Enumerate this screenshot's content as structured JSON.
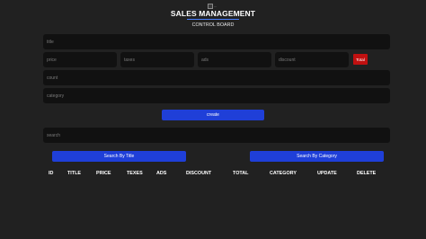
{
  "header": {
    "title": "SALES MANAGEMENT",
    "subtitle": "CONTROL BOARD",
    "logo_alt": "...",
    "underline_color": "#4a7fff"
  },
  "form": {
    "title_placeholder": "title",
    "price_placeholder": "price",
    "taxes_placeholder": "taxes",
    "ads_placeholder": "ads",
    "discount_placeholder": "discount",
    "total_label": "Total",
    "count_placeholder": "count",
    "category_placeholder": "category",
    "create_label": "create"
  },
  "search": {
    "placeholder": "search",
    "by_title_label": "Search By Title",
    "by_category_label": "Search By Category"
  },
  "table": {
    "headers": [
      "ID",
      "TITLE",
      "PRICE",
      "TEXES",
      "ADS",
      "DISCOUNT",
      "TOTAL",
      "CATEGORY",
      "UPDATE",
      "DELETE"
    ]
  },
  "colors": {
    "background": "#212121",
    "field": "#111111",
    "button": "#1f3fd8",
    "total_badge": "#c01010"
  }
}
